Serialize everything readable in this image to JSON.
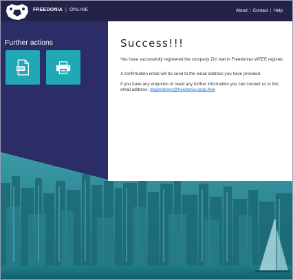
{
  "header": {
    "brand_name": "FREEDONIA",
    "brand_separator": "|",
    "brand_suffix": "ONLINE",
    "nav": [
      {
        "label": "About"
      },
      {
        "label": "Contact"
      },
      {
        "label": "Help"
      }
    ],
    "nav_separator": "|"
  },
  "sidebar": {
    "title": "Further actions",
    "actions": [
      {
        "icon": "pdf-icon"
      },
      {
        "icon": "printer-icon"
      }
    ]
  },
  "main": {
    "heading": "Success!!!",
    "paragraph1": "You have successfully registered the company Zizi mat in Freedonias WEEE register.",
    "paragraph2": "A confirmation email will be send to the email address you have provided.",
    "paragraph3_prefix": "If you have any enquiries or need any further information you can contact us in this email address: ",
    "contact_email": "registrations@freedonia-opsp.free"
  },
  "colors": {
    "header_bg": "#23234a",
    "sidebar_bg": "#2c2c66",
    "accent_teal": "#20a9b5",
    "link": "#2a6fc9"
  }
}
